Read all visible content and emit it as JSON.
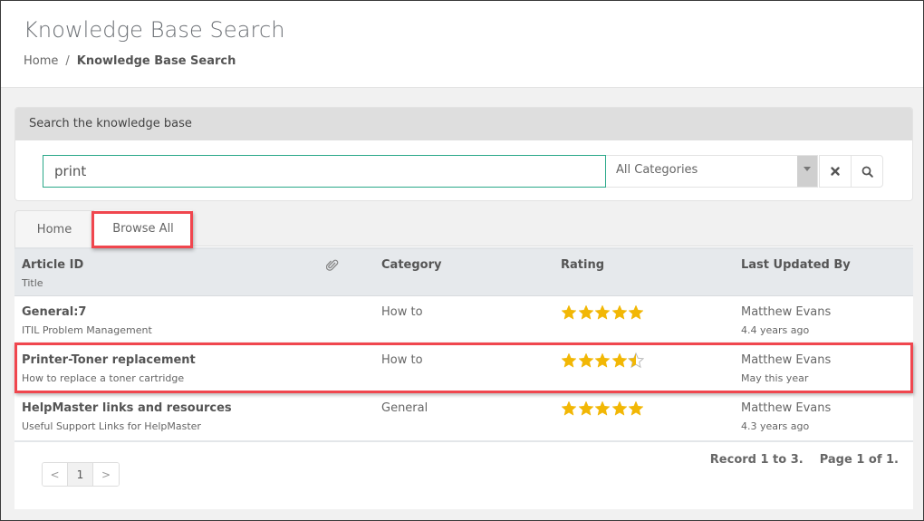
{
  "header": {
    "title": "Knowledge Base Search",
    "breadcrumb": [
      {
        "label": "Home"
      },
      {
        "label": "Knowledge Base Search"
      }
    ],
    "breadcrumb_separator": "/"
  },
  "search": {
    "panel_title": "Search the knowledge base",
    "query": "print",
    "category": "All Categories",
    "clear_icon": "close-icon",
    "search_icon": "search-icon"
  },
  "tabs": [
    {
      "label": "Home",
      "active": false
    },
    {
      "label": "Browse All",
      "active": true
    }
  ],
  "table": {
    "columns": {
      "article_id": "Article ID",
      "title": "Title",
      "attachment_icon": "paperclip-icon",
      "category": "Category",
      "rating": "Rating",
      "last_updated_by": "Last Updated By"
    },
    "rows": [
      {
        "id": "General:7",
        "title": "ITIL Problem Management",
        "category": "How to",
        "rating": 5,
        "user": "Matthew Evans",
        "when": "4.4 years ago",
        "highlighted": false
      },
      {
        "id": "Printer-Toner replacement",
        "title": "How to replace a toner cartridge",
        "category": "How to",
        "rating": 4.5,
        "user": "Matthew Evans",
        "when": "May this year",
        "highlighted": true
      },
      {
        "id": "HelpMaster links and resources",
        "title": "Useful Support Links for HelpMaster",
        "category": "General",
        "rating": 5,
        "user": "Matthew Evans",
        "when": "4.3 years ago",
        "highlighted": false
      }
    ],
    "max_rating": 5
  },
  "pagination": {
    "prev": "<",
    "current": "1",
    "next": ">",
    "record_text": "Record 1 to 3.",
    "page_text": "Page 1 of 1."
  },
  "colors": {
    "star": "#f2b705",
    "star_empty": "#bbbbbb",
    "highlight": "#f0464e",
    "input_focus": "#2aa889"
  }
}
